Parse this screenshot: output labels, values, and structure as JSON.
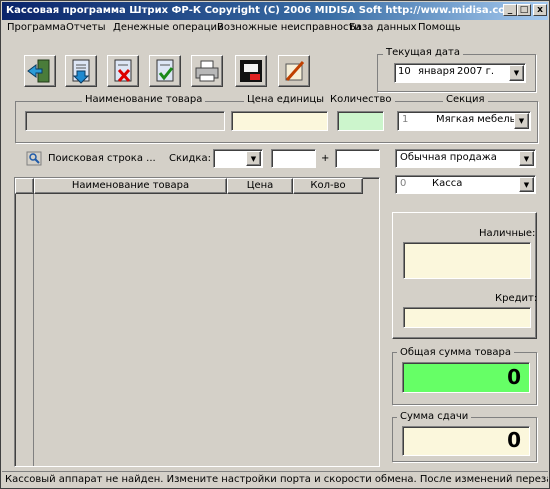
{
  "window": {
    "title": "Кассовая программа Штрих ФР-К Copyright (C) 2006 MIDISA Soft http://www.midisa.com",
    "minimize": "_",
    "maximize": "□",
    "close": "x"
  },
  "menu": [
    "Программа",
    "Отчеты",
    "Денежные операции",
    "Возножные неисправности",
    "База данных",
    "Помощь"
  ],
  "date_group": {
    "label": "Текущая дата",
    "day": "10",
    "month": "января",
    "year": "2007 г."
  },
  "product": {
    "name_label": "Наименование товара",
    "price_label": "Цена единицы",
    "qty_label": "Количество",
    "section_label": "Секция",
    "section_num": "1",
    "section_value": "Мягкая мебель"
  },
  "search": {
    "label": "Поисковая строка ...",
    "discount_label": "Скидка:",
    "plus": "+"
  },
  "table": {
    "headers": [
      "Наименование товара",
      "Цена",
      "Кол-во"
    ]
  },
  "sale_type": "Обычная продажа",
  "cashbox": {
    "num": "0",
    "value": "Касса"
  },
  "payment": {
    "cash_label": "Наличные:",
    "credit_label": "Кредит:"
  },
  "total": {
    "label": "Общая сумма товара",
    "value": "0",
    "color": "#66ff66"
  },
  "change": {
    "label": "Сумма сдачи",
    "value": "0"
  },
  "status": "Кассовый аппарат не найден. Измените настройки порта и скорости обмена. После изменений перезапустите програм",
  "colors": {
    "title_start": "#0a246a",
    "field_yellow": "#fbf7dc",
    "field_green": "#ccf5cc",
    "total_green": "#66ff66"
  }
}
